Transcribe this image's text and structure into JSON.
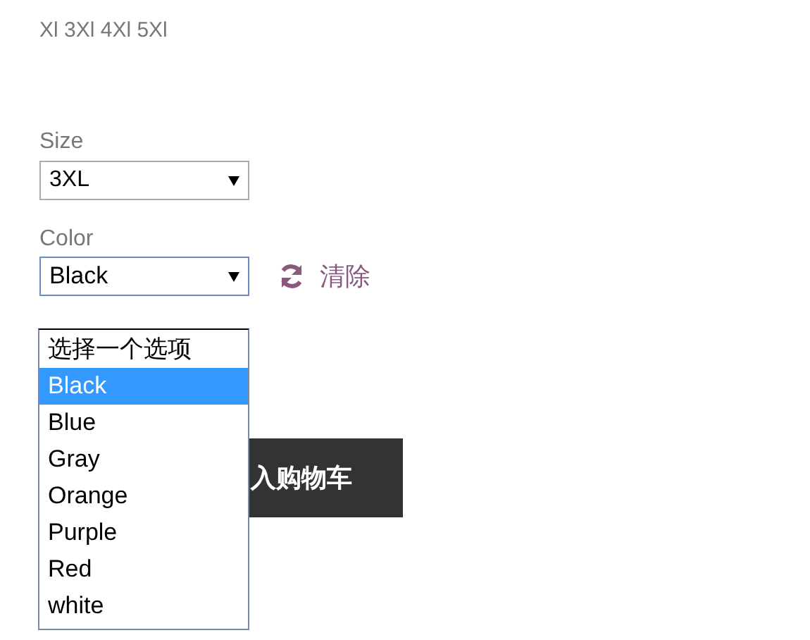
{
  "sizes_text": "Xl 3Xl 4Xl 5Xl",
  "size": {
    "label": "Size",
    "value": "3XL"
  },
  "color": {
    "label": "Color",
    "value": "Black",
    "clear_label": "清除"
  },
  "color_options": [
    {
      "label": "选择一个选项",
      "selected": false
    },
    {
      "label": "Black",
      "selected": true
    },
    {
      "label": "Blue",
      "selected": false
    },
    {
      "label": "Gray",
      "selected": false
    },
    {
      "label": "Orange",
      "selected": false
    },
    {
      "label": "Purple",
      "selected": false
    },
    {
      "label": "Red",
      "selected": false
    },
    {
      "label": "white",
      "selected": false
    }
  ],
  "add_to_cart_button": "入购物车"
}
